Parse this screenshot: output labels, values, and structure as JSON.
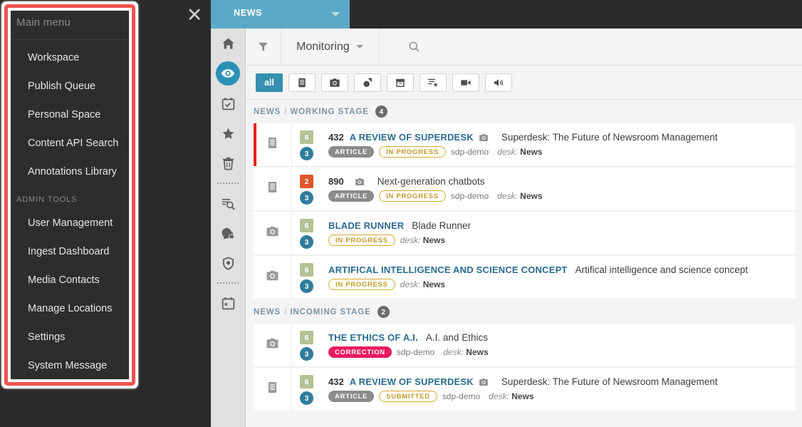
{
  "menu": {
    "title": "Main menu",
    "close_icon": "close-icon",
    "items": [
      {
        "label": "Workspace",
        "type": "item"
      },
      {
        "label": "Publish Queue",
        "type": "item"
      },
      {
        "label": "Personal Space",
        "type": "item"
      },
      {
        "label": "Content API Search",
        "type": "item"
      },
      {
        "label": "Annotations Library",
        "type": "item"
      },
      {
        "label": "ADMIN TOOLS",
        "type": "group"
      },
      {
        "label": "User Management",
        "type": "item"
      },
      {
        "label": "Ingest Dashboard",
        "type": "item"
      },
      {
        "label": "Media Contacts",
        "type": "item"
      },
      {
        "label": "Manage Locations",
        "type": "item"
      },
      {
        "label": "Settings",
        "type": "item"
      },
      {
        "label": "System Message",
        "type": "item"
      }
    ],
    "highlight_color": "#f0514f"
  },
  "tabbar": {
    "active_tab": "NEWS",
    "tab_color": "#5ba9c6",
    "caret_icon": "chevron-down-icon"
  },
  "rail": {
    "items": [
      {
        "name": "home-icon",
        "active": false
      },
      {
        "name": "monitoring-eye-icon",
        "active": true
      },
      {
        "name": "tasks-calendar-icon",
        "active": false
      },
      {
        "name": "highlights-star-icon",
        "active": false
      },
      {
        "name": "spike-trash-icon",
        "active": false
      },
      {
        "name": "divider",
        "active": false
      },
      {
        "name": "search-document-icon",
        "active": false
      },
      {
        "name": "user-privileges-icon",
        "active": false
      },
      {
        "name": "security-shield-icon",
        "active": false
      },
      {
        "name": "divider",
        "active": false
      },
      {
        "name": "calendar-icon",
        "active": false
      }
    ],
    "active_color": "#2a91b5"
  },
  "toolbar": {
    "filter_icon": "filter-icon",
    "title": "Monitoring",
    "title_caret_icon": "chevron-down-icon",
    "search_icon": "search-icon"
  },
  "chips": [
    {
      "label": "all",
      "icon": "",
      "selected": true,
      "name": "filter-all"
    },
    {
      "label": "",
      "icon": "text-document-icon",
      "selected": false,
      "name": "filter-text"
    },
    {
      "label": "",
      "icon": "camera-icon",
      "selected": false,
      "name": "filter-picture"
    },
    {
      "label": "",
      "icon": "graphic-icon",
      "selected": false,
      "name": "filter-graphic"
    },
    {
      "label": "",
      "icon": "package-icon",
      "selected": false,
      "name": "filter-package"
    },
    {
      "label": "",
      "icon": "composite-list-star-icon",
      "selected": false,
      "name": "filter-composite"
    },
    {
      "label": "",
      "icon": "video-camera-icon",
      "selected": false,
      "name": "filter-video"
    },
    {
      "label": "",
      "icon": "audio-speaker-icon",
      "selected": false,
      "name": "filter-audio"
    }
  ],
  "stages": [
    {
      "desk": "NEWS",
      "separator": "/",
      "stage": "WORKING STAGE",
      "count": "4",
      "items": [
        {
          "marked": true,
          "type_icon": "text-document-icon",
          "badge_square": {
            "value": "6",
            "color": "#b5c196"
          },
          "badge_circle": {
            "value": "3",
            "color": "#2e7d9e"
          },
          "number": "432",
          "slug": "A REVIEW OF SUPERDESK",
          "attachment_icon": "camera-icon",
          "headline": "Superdesk: The Future of Newsroom Management",
          "pills": [
            {
              "label": "ARTICLE",
              "style": "article"
            },
            {
              "label": "IN PROGRESS",
              "style": "state"
            }
          ],
          "user": "sdp-demo",
          "desk_label": "desk:",
          "desk_value": "News"
        },
        {
          "marked": false,
          "type_icon": "text-document-icon",
          "badge_square": {
            "value": "2",
            "color": "#e2552b"
          },
          "badge_circle": {
            "value": "3",
            "color": "#2e7d9e"
          },
          "number": "890",
          "slug": "",
          "attachment_icon": "camera-icon",
          "headline": "Next-generation chatbots",
          "pills": [
            {
              "label": "ARTICLE",
              "style": "article"
            },
            {
              "label": "IN PROGRESS",
              "style": "state"
            }
          ],
          "user": "sdp-demo",
          "desk_label": "desk:",
          "desk_value": "News"
        },
        {
          "marked": false,
          "type_icon": "camera-icon",
          "badge_square": {
            "value": "6",
            "color": "#b5c196"
          },
          "badge_circle": {
            "value": "3",
            "color": "#2e7d9e"
          },
          "number": "",
          "slug": "BLADE RUNNER",
          "attachment_icon": "",
          "headline": "Blade Runner",
          "pills": [
            {
              "label": "IN PROGRESS",
              "style": "state"
            }
          ],
          "user": "",
          "desk_label": "desk:",
          "desk_value": "News"
        },
        {
          "marked": false,
          "type_icon": "camera-icon",
          "badge_square": {
            "value": "6",
            "color": "#b5c196"
          },
          "badge_circle": {
            "value": "3",
            "color": "#2e7d9e"
          },
          "number": "",
          "slug": "ARTIFICAL INTELLIGENCE AND SCIENCE CONCEPT",
          "attachment_icon": "",
          "headline": "Artifical intelligence and science concept",
          "pills": [
            {
              "label": "IN PROGRESS",
              "style": "state"
            }
          ],
          "user": "",
          "desk_label": "desk:",
          "desk_value": "News"
        }
      ]
    },
    {
      "desk": "NEWS",
      "separator": "/",
      "stage": "INCOMING STAGE",
      "count": "2",
      "items": [
        {
          "marked": false,
          "type_icon": "camera-icon",
          "badge_square": {
            "value": "6",
            "color": "#b5c196"
          },
          "badge_circle": {
            "value": "3",
            "color": "#2e7d9e"
          },
          "number": "",
          "slug": "THE ETHICS OF A.I.",
          "attachment_icon": "",
          "headline": "A.I. and Ethics",
          "pills": [
            {
              "label": "CORRECTION",
              "style": "correction"
            }
          ],
          "user": "sdp-demo",
          "desk_label": "desk:",
          "desk_value": "News"
        },
        {
          "marked": false,
          "type_icon": "text-document-icon",
          "badge_square": {
            "value": "6",
            "color": "#b5c196"
          },
          "badge_circle": {
            "value": "3",
            "color": "#2e7d9e"
          },
          "number": "432",
          "slug": "A REVIEW OF SUPERDESK",
          "attachment_icon": "camera-icon",
          "headline": "Superdesk: The Future of Newsroom Management",
          "pills": [
            {
              "label": "ARTICLE",
              "style": "article"
            },
            {
              "label": "SUBMITTED",
              "style": "state"
            }
          ],
          "user": "sdp-demo",
          "desk_label": "desk:",
          "desk_value": "News"
        }
      ]
    }
  ]
}
